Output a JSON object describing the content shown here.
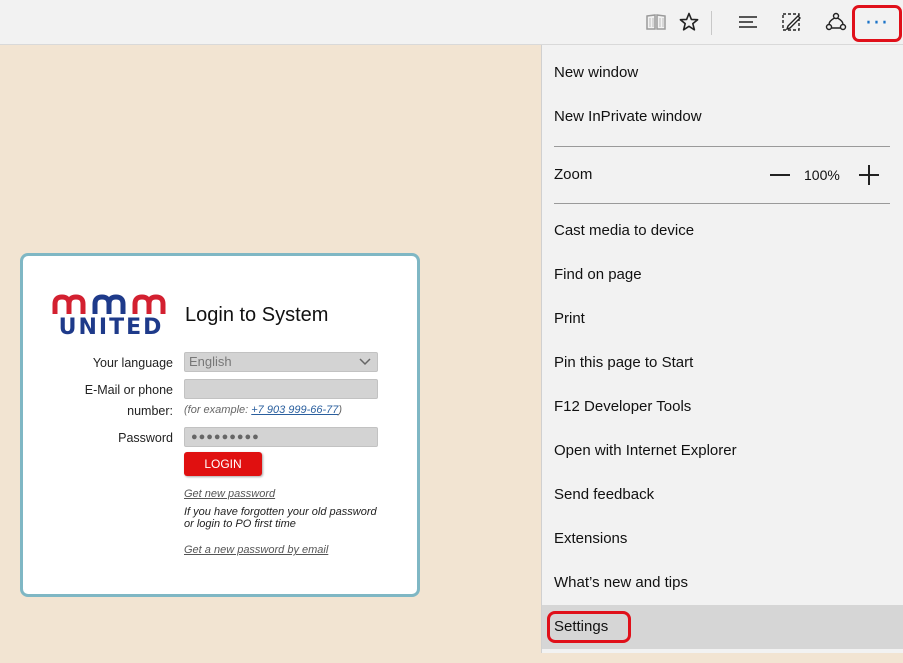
{
  "toolbar": {
    "icons": [
      "reading-view-icon",
      "favorite-star-icon",
      "hub-icon",
      "web-note-icon",
      "share-icon",
      "more-actions-icon"
    ],
    "more_label": "···",
    "highlight_color": "#e0101a"
  },
  "login": {
    "logo_text": "UNITED",
    "title": "Login to System",
    "language_label": "Your language",
    "language_value": "English",
    "email_label_line1": "E-Mail or phone",
    "email_label_line2": "number:",
    "example_prefix": "(for example: ",
    "example_phone": "+7 903 999-66-77",
    "example_suffix": ")",
    "password_label": "Password",
    "password_value": "●●●●●●●●●",
    "login_button": "LOGIN",
    "get_new_password": "Get new password",
    "forgot_note": "If you have forgotten your old password or login to PO first time",
    "get_password_email": "Get a new password by email"
  },
  "menu": {
    "new_window": "New window",
    "new_inprivate": "New InPrivate window",
    "zoom_label": "Zoom",
    "zoom_value": "100%",
    "cast_media": "Cast media to device",
    "find_on_page": "Find on page",
    "print": "Print",
    "pin_to_start": "Pin this page to Start",
    "f12_tools": "F12 Developer Tools",
    "open_ie": "Open with Internet Explorer",
    "send_feedback": "Send feedback",
    "extensions": "Extensions",
    "whats_new": "What’s new and tips",
    "settings": "Settings"
  },
  "colors": {
    "page_background": "#f2e4d2",
    "card_border": "#7fb7c4",
    "login_button": "#e01010",
    "logo_blue": "#1e3a8a",
    "logo_red": "#d32030"
  }
}
